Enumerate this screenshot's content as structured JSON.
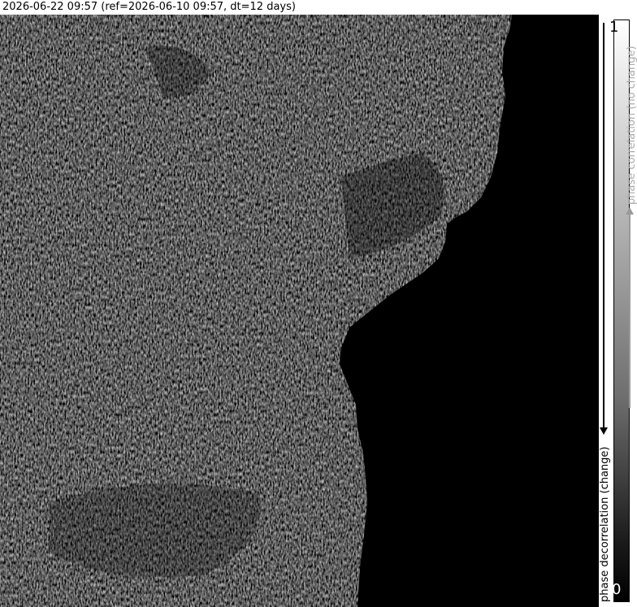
{
  "title": "2026-06-22 09:57 (ref=2026-06-10 09:57, dt=12 days)",
  "colorbar": {
    "max_label": "1",
    "min_label": "0",
    "high_end_label": "phase correlation (no change)",
    "low_end_label": "phase decorrelation (change)"
  },
  "image": {
    "description_icon": "sar-coherence-map",
    "colormap": "grayscale"
  }
}
